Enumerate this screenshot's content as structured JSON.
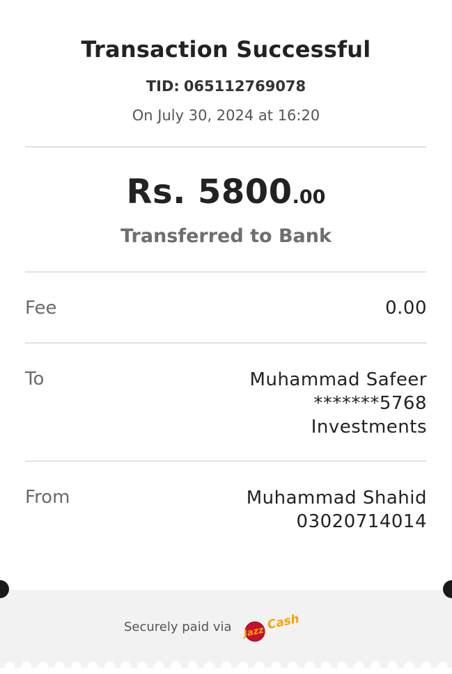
{
  "header": {
    "title": "Transaction Successful",
    "tid_label": "TID:",
    "tid_value": "065112769078",
    "datetime": "On July 30, 2024 at 16:20"
  },
  "amount": {
    "main": "Rs. 5800",
    "cents": ".00",
    "type": "Transferred to Bank"
  },
  "details": {
    "fee": {
      "label": "Fee",
      "value": "0.00"
    },
    "to": {
      "label": "To",
      "name": "Muhammad Safeer",
      "account": "*******5768",
      "bank": "Investments"
    },
    "from": {
      "label": "From",
      "name": "Muhammad Shahid",
      "number": "03020714014"
    }
  },
  "footer": {
    "secure_text": "Securely paid via",
    "logo_text": "JazzCash",
    "logo_colors": {
      "jazz": "#c8102e",
      "cash": "#f7a600"
    }
  }
}
